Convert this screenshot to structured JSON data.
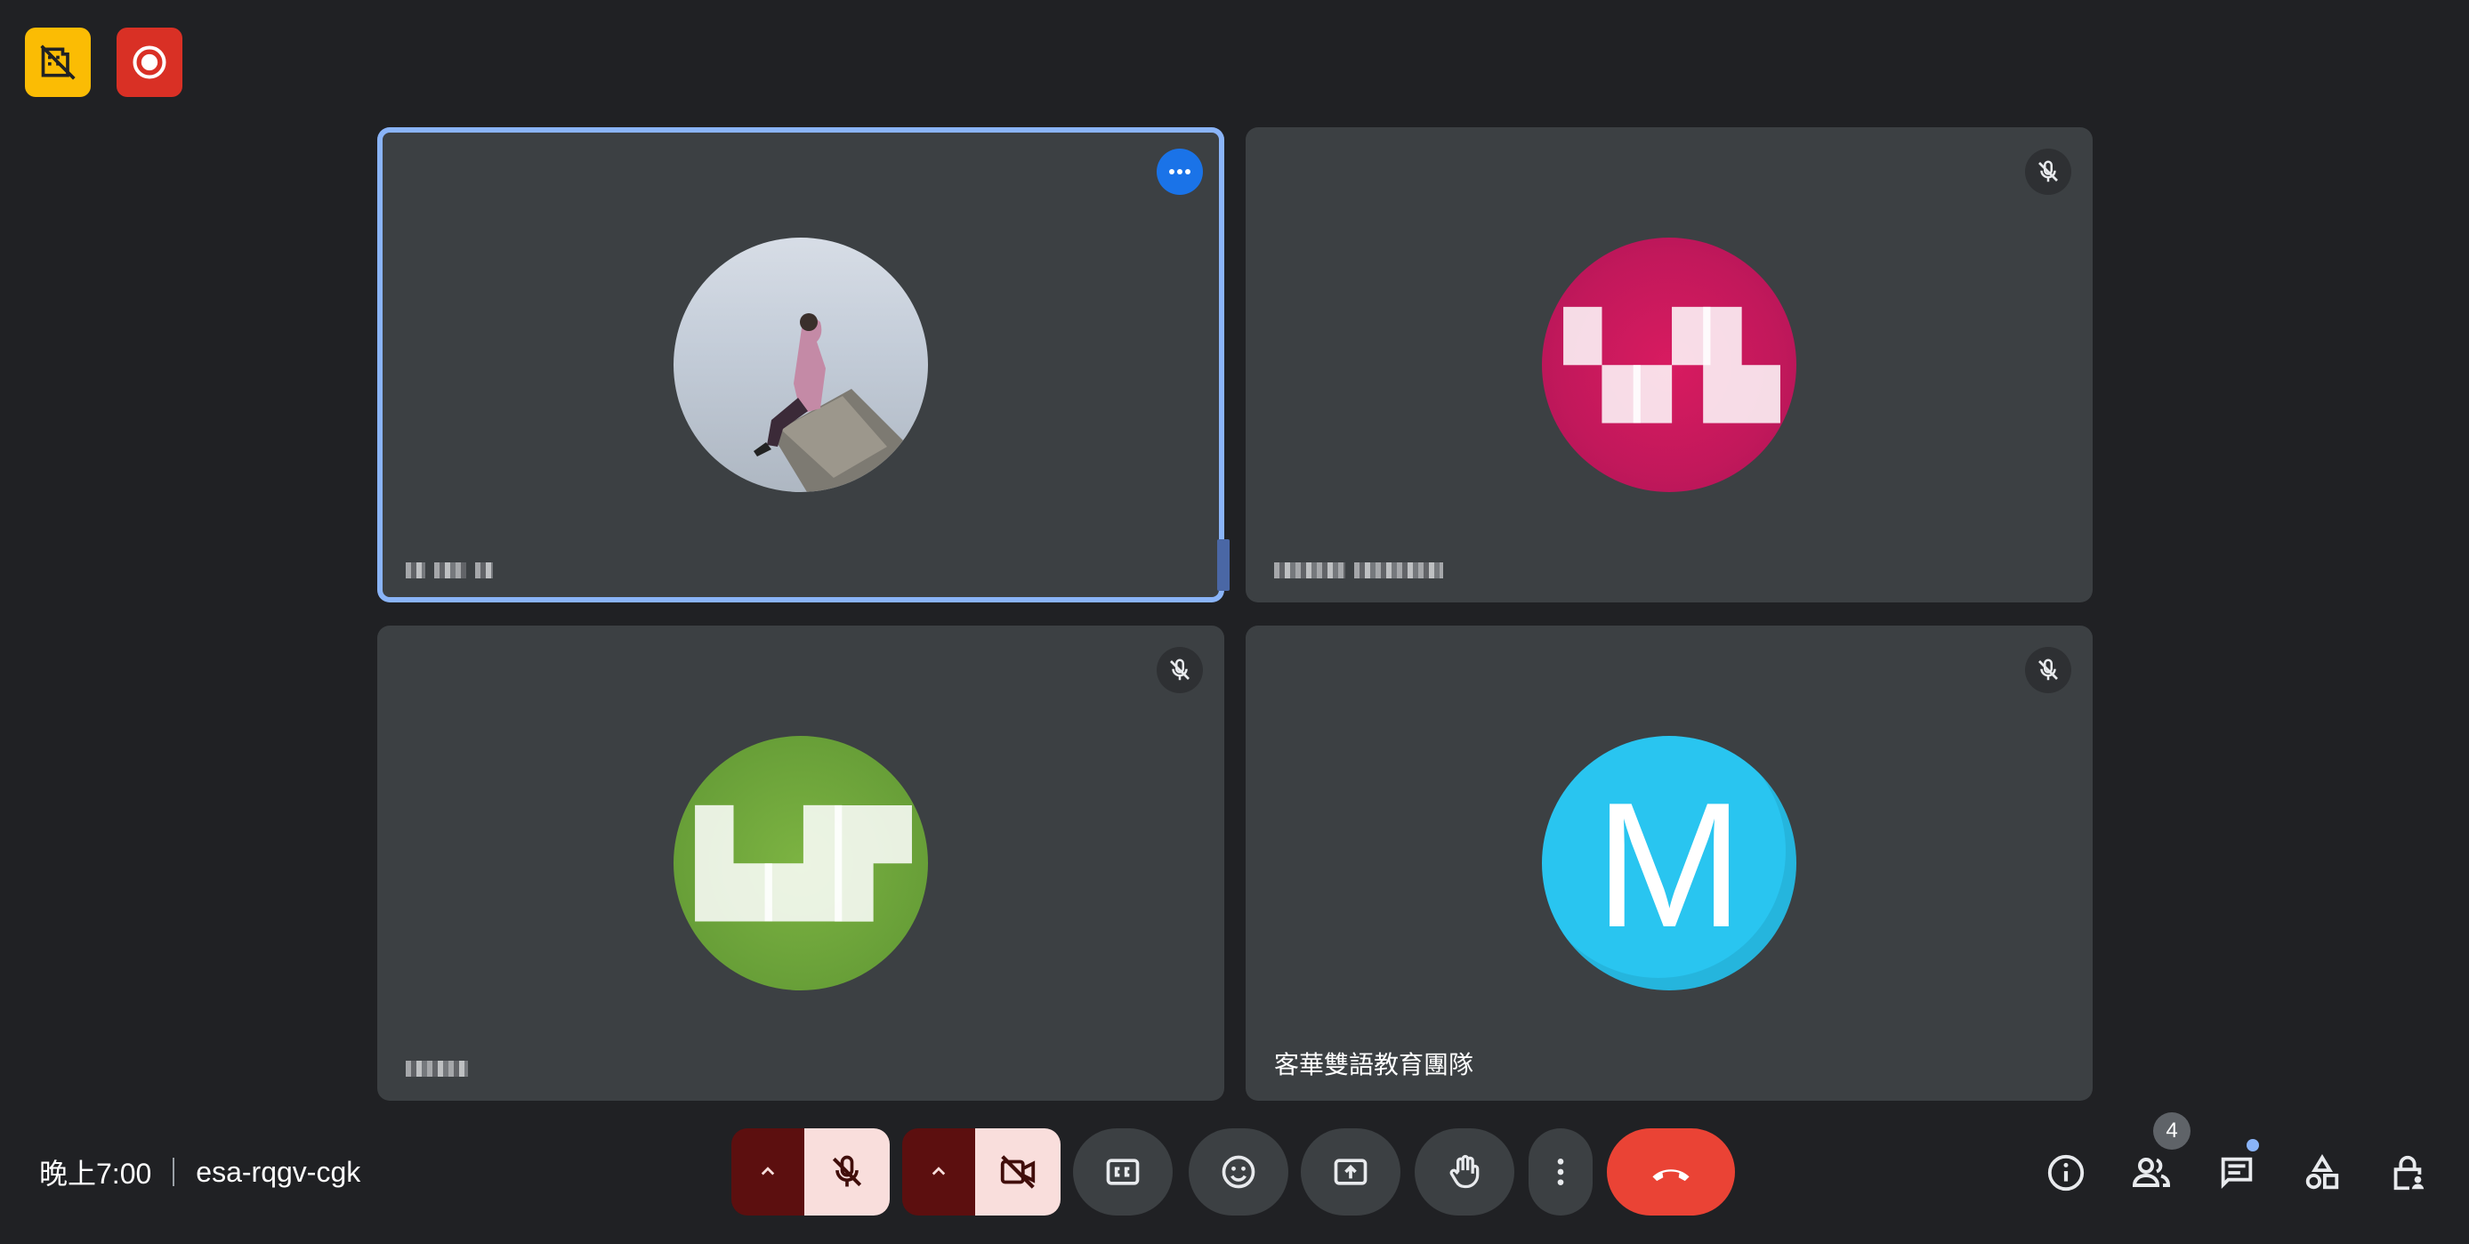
{
  "top_badges": [
    {
      "icon": "no-recording-area-icon",
      "color": "#fbbc04"
    },
    {
      "icon": "record-icon",
      "color": "#d93025"
    }
  ],
  "tiles": [
    {
      "name": "",
      "avatar": "photo",
      "state": "active"
    },
    {
      "name": "",
      "avatar": "pink-text",
      "state": "muted"
    },
    {
      "name": "",
      "avatar": "green-text",
      "state": "muted"
    },
    {
      "name": "客華雙語教育團隊",
      "avatar_letter": "M",
      "state": "muted"
    }
  ],
  "meeting": {
    "time": "晚上7:00",
    "code": "esa-rqgv-cgk"
  },
  "controls": {
    "mic_state": "off",
    "camera_state": "off"
  },
  "people_count": "4",
  "colors": {
    "background": "#202124",
    "tile": "#3c4043",
    "active_border": "#8ab4f8",
    "end_call": "#ea4335",
    "avatar_m": "#29c5f0",
    "avatar_pink": "#c2185b",
    "avatar_green": "#689f38"
  }
}
